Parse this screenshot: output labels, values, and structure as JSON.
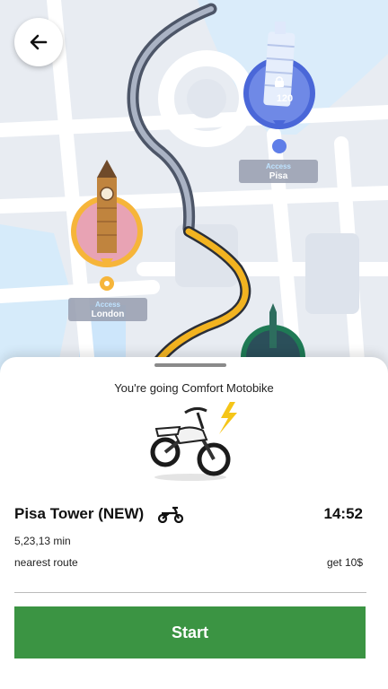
{
  "map": {
    "landmarks": [
      {
        "id": "pisa",
        "access_label": "Access",
        "name": "Pisa",
        "lock_count": "120",
        "locked": true
      },
      {
        "id": "london",
        "access_label": "Access",
        "name": "London",
        "locked": false
      }
    ]
  },
  "sheet": {
    "subtitle": "You're going Comfort Motobike",
    "destination": "Pisa Tower (NEW)",
    "eta": "14:52",
    "duration": "5,23,13 min",
    "route_type": "nearest route",
    "reward": "get 10$",
    "start_label": "Start"
  },
  "colors": {
    "route": "#f2b320",
    "start_button": "#3b9443",
    "pisa_marker": "#4a67d8",
    "london_marker": "#f6b53a"
  }
}
